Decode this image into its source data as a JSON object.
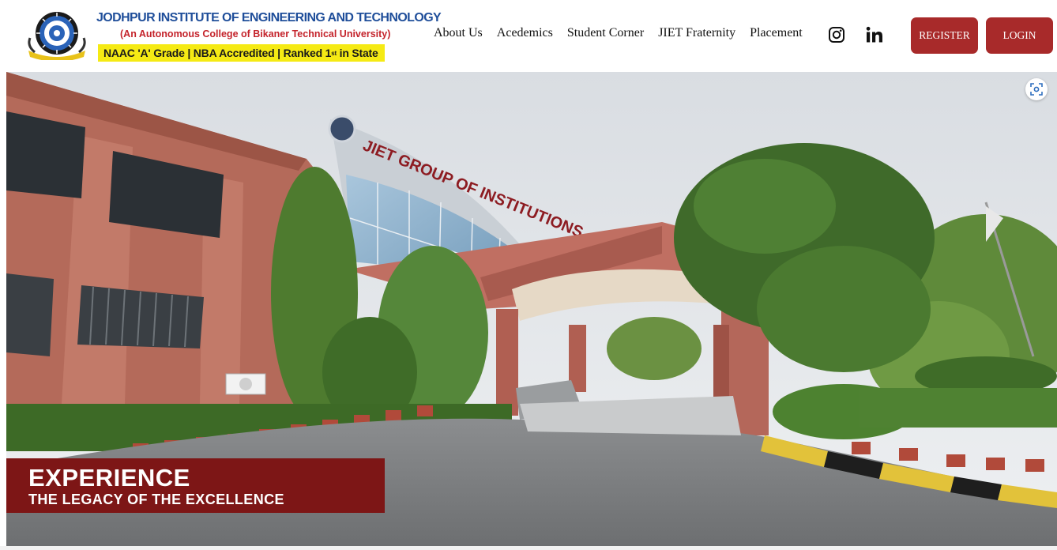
{
  "header": {
    "brand": {
      "title": "JODHPUR INSTITUTE OF ENGINEERING AND TECHNOLOGY",
      "subtitle": "(An Autonomous College of Bikaner Technical University)",
      "badge_prefix": "NAAC 'A' Grade | NBA Accredited | Ranked 1",
      "badge_sup": "st",
      "badge_suffix": " in State",
      "logo_icon": "college-emblem"
    },
    "nav": [
      "About Us",
      "Acedemics",
      "Student Corner",
      "JIET Fraternity",
      "Placement"
    ],
    "social": {
      "instagram_icon": "instagram-icon",
      "linkedin_icon": "linkedin-icon"
    },
    "buttons": {
      "register": "REGISTER",
      "login": "LOGIN"
    },
    "colors": {
      "brand_blue": "#1f4e9a",
      "brand_red": "#c4232b",
      "badge_yellow": "#f5ea14",
      "button_red": "#a82a2a"
    }
  },
  "hero": {
    "image": "campus-entrance-panorama",
    "building_sign": "JIET GROUP OF INSTITUTIONS",
    "caption": {
      "title": "EXPERIENCE",
      "subtitle": "THE LEGACY OF THE EXCELLENCE",
      "background": "#7d1616"
    },
    "scan_icon": "fullscreen-scan-icon"
  }
}
